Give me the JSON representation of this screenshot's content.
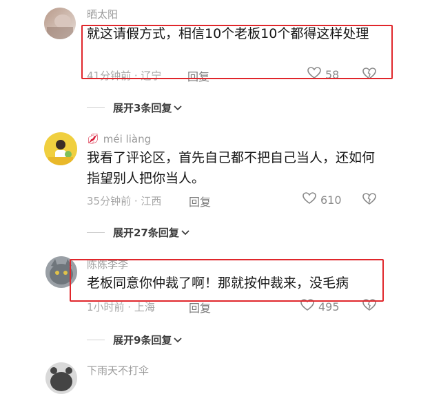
{
  "comments": [
    {
      "username": "晒太阳",
      "text": "就这请假方式，相信10个老板10个都得这样处理",
      "time_location": "41分钟前 · 辽宁",
      "reply_label": "回复",
      "likes": "58",
      "expand_label": "展开3条回复",
      "highlighted": true
    },
    {
      "username": "méi liàng",
      "text": "我看了评论区，首先自己都不把自己当人，还如何指望别人把你当人。",
      "time_location": "35分钟前 · 江西",
      "reply_label": "回复",
      "likes": "610",
      "expand_label": "展开27条回复",
      "highlighted": false
    },
    {
      "username": "陈陈李李",
      "text": "老板同意你仲裁了啊！那就按仲裁来，没毛病",
      "time_location": "1小时前 · 上海",
      "reply_label": "回复",
      "likes": "495",
      "expand_label": "展开9条回复",
      "highlighted": true
    },
    {
      "username": "下雨天不打伞"
    }
  ],
  "colors": {
    "highlight_box": "#e0262b",
    "username": "#9a9a9a",
    "meta": "#a7a7a7"
  },
  "icons": [
    "heart-outline-icon",
    "broken-heart-icon",
    "chevron-down-icon",
    "lips-emoji-icon"
  ]
}
